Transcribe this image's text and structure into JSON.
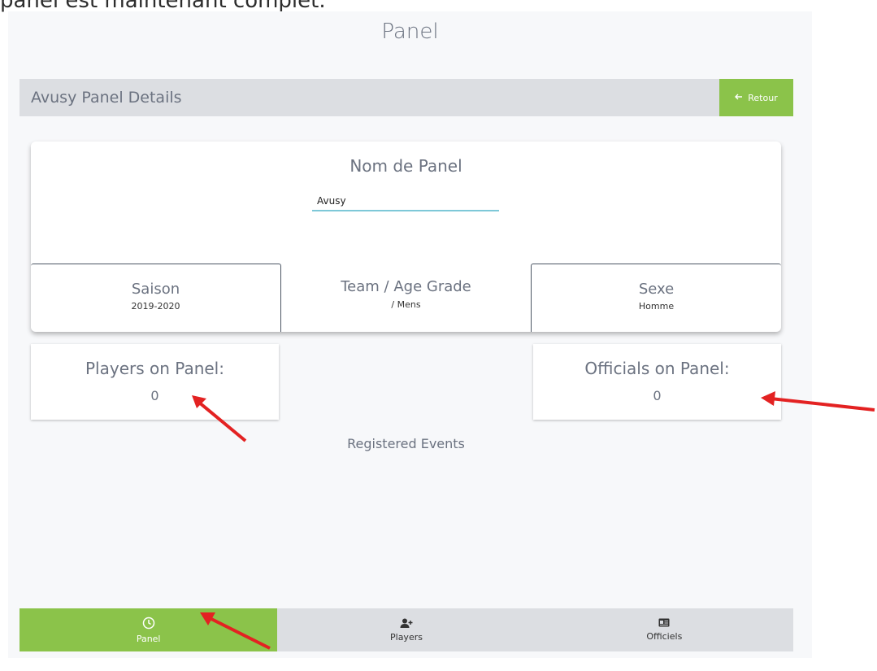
{
  "caption": "panel est maintenant complet.",
  "page_title": "Panel",
  "details_bar": {
    "title": "Avusy Panel Details",
    "back_label": "Retour",
    "back_icon": "arrow-left-icon"
  },
  "panel_card": {
    "name_label": "Nom de Panel",
    "name_value": "Avusy",
    "season_label": "Saison",
    "season_value": "2019-2020",
    "team_label": "Team / Age Grade",
    "team_value": "/ Mens",
    "sex_label": "Sexe",
    "sex_value": "Homme"
  },
  "players_card": {
    "label": "Players on Panel:",
    "value": "0"
  },
  "officials_card": {
    "label": "Officials on Panel:",
    "value": "0"
  },
  "registered_events": "Registered Events",
  "bottom_nav": {
    "items": [
      {
        "label": "Panel",
        "icon": "clock-icon",
        "active": true
      },
      {
        "label": "Players",
        "icon": "add-user-icon",
        "active": false
      },
      {
        "label": "Officiels",
        "icon": "id-card-icon",
        "active": false
      }
    ]
  },
  "colors": {
    "accent": "#8bc34a",
    "bar": "#dcdee2",
    "annotation_arrow": "#e32222"
  }
}
